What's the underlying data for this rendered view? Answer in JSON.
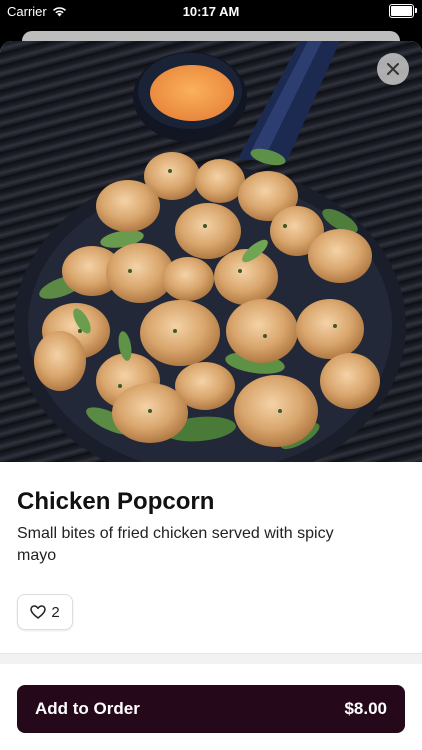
{
  "status_bar": {
    "carrier": "Carrier",
    "time": "10:17 AM"
  },
  "item": {
    "name": "Chicken Popcorn",
    "description": "Small bites of fried chicken served with spicy mayo",
    "likes": "2",
    "image_description": "Fried chicken bites on a black skillet with greens and a cup of spicy mayo"
  },
  "order_button": {
    "label": "Add to Order",
    "price": "$8.00",
    "color": "#25091b"
  }
}
